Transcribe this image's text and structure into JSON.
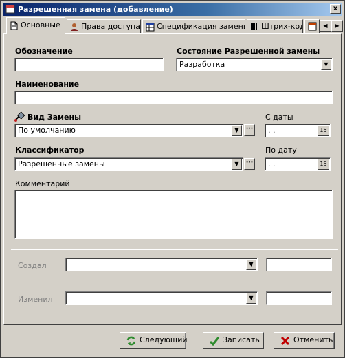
{
  "window": {
    "title": "Разрешенная замена (добавление)",
    "close_label": "x"
  },
  "tabs": [
    {
      "label": "Основные",
      "icon": "document-icon"
    },
    {
      "label": "Права доступа",
      "icon": "user-key-icon"
    },
    {
      "label": "Спецификация замены",
      "icon": "table-icon"
    },
    {
      "label": "Штрих-код",
      "icon": "barcode-icon"
    }
  ],
  "form": {
    "designation_label": "Обозначение",
    "designation_value": "",
    "state_label": "Состояние Разрешенной замены",
    "state_value": "Разработка",
    "name_label": "Наименование",
    "name_value": "",
    "kind_label": "Вид Замены",
    "kind_value": "По умолчанию",
    "date_from_label": "С даты",
    "date_from_value": " .  .",
    "classifier_label": "Классификатор",
    "classifier_value": "Разрешенные замены",
    "date_to_label": "По дату",
    "date_to_value": " .  .",
    "comment_label": "Комментарий",
    "comment_value": "",
    "created_label": "Создал",
    "created_value": "",
    "created_extra": "",
    "changed_label": "Изменил",
    "changed_value": "",
    "changed_extra": "",
    "ellipsis": "···",
    "calendar_label": "15"
  },
  "buttons": {
    "next": "Следующий",
    "save": "Записать",
    "cancel": "Отменить"
  },
  "colors": {
    "titlebar": "#0a246a",
    "face": "#d4d0c8",
    "next_icon": "#2e8b2e",
    "save_icon": "#2e8b2e",
    "cancel_icon": "#c00000"
  }
}
